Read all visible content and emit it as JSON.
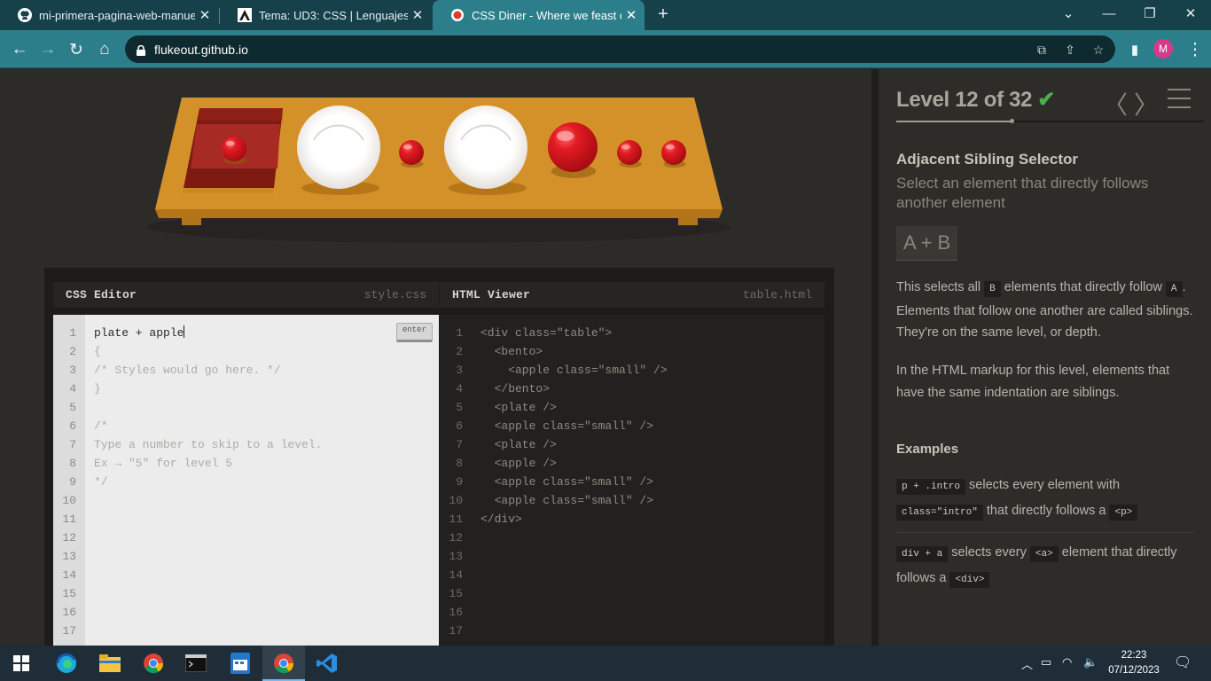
{
  "browser": {
    "tabs": [
      {
        "title": "mi-primera-pagina-web-manuel",
        "icon": "github-icon"
      },
      {
        "title": "Tema: UD3: CSS | Lenguajes de m",
        "icon": "moodle-icon"
      },
      {
        "title": "CSS Diner - Where we feast on C",
        "icon": "css-diner-icon",
        "active": true
      }
    ],
    "new_tab": "+",
    "url": "flukeout.github.io",
    "avatar_letter": "M"
  },
  "editor": {
    "css_pane": {
      "name": "CSS Editor",
      "file": "style.css",
      "enter_label": "enter"
    },
    "html_pane": {
      "name": "HTML Viewer",
      "file": "table.html"
    },
    "input_value": "plate + apple",
    "css_lines": [
      "{",
      "/* Styles would go here. */",
      "}",
      "",
      "/*",
      "Type a number to skip to a level.",
      "Ex → \"5\" for level 5",
      "*/"
    ],
    "html_lines": [
      "<div class=\"table\">",
      "  <bento>",
      "    <apple class=\"small\" />",
      "  </bento>",
      "  <plate />",
      "  <apple class=\"small\" />",
      "  <plate />",
      "  <apple />",
      "  <apple class=\"small\" />",
      "  <apple class=\"small\" />",
      "</div>"
    ],
    "line_numbers": [
      "1",
      "2",
      "3",
      "4",
      "5",
      "6",
      "7",
      "8",
      "9",
      "10",
      "11",
      "12",
      "13",
      "14",
      "15",
      "16",
      "17"
    ]
  },
  "table": {
    "items": [
      {
        "type": "bento",
        "child": "small-apple"
      },
      {
        "type": "plate"
      },
      {
        "type": "small-apple"
      },
      {
        "type": "plate"
      },
      {
        "type": "apple"
      },
      {
        "type": "small-apple"
      },
      {
        "type": "small-apple"
      }
    ]
  },
  "level": {
    "heading": "Level 12 of 32",
    "completed": true,
    "progress": 0.375,
    "title": "Adjacent Sibling Selector",
    "subtitle": "Select an element that directly follows another element",
    "syntax": "A + B",
    "desc_1_a": "This selects all",
    "desc_1_code_b": "B",
    "desc_1_b": "elements that directly follow",
    "desc_1_code_a": "A",
    "desc_1_c": ". Elements that follow one another are called siblings. They're on the same level, or depth.",
    "desc_2": "In the HTML markup for this level, elements that have the same indentation are siblings.",
    "examples_heading": "Examples",
    "ex1_code": "p + .intro",
    "ex1_text_a": "selects every element with",
    "ex1_code2": "class=\"intro\"",
    "ex1_text_b": "that directly follows a",
    "ex1_code3": "<p>",
    "ex2_code": "div + a",
    "ex2_text_a": "selects every",
    "ex2_code2": "<a>",
    "ex2_text_b": "element that directly follows a",
    "ex2_code3": "<div>"
  },
  "taskbar": {
    "time": "22:23",
    "date": "07/12/2023",
    "apps": [
      "windows-start-icon",
      "edge-icon",
      "file-explorer-icon",
      "chrome-icon",
      "terminal-icon",
      "calendar-app-icon",
      "chrome-active-icon",
      "vscode-icon"
    ]
  },
  "colors": {
    "accent": "#2c7f8a",
    "table": "#d4912a",
    "apple": "#d8131d",
    "check": "#4caf50"
  }
}
